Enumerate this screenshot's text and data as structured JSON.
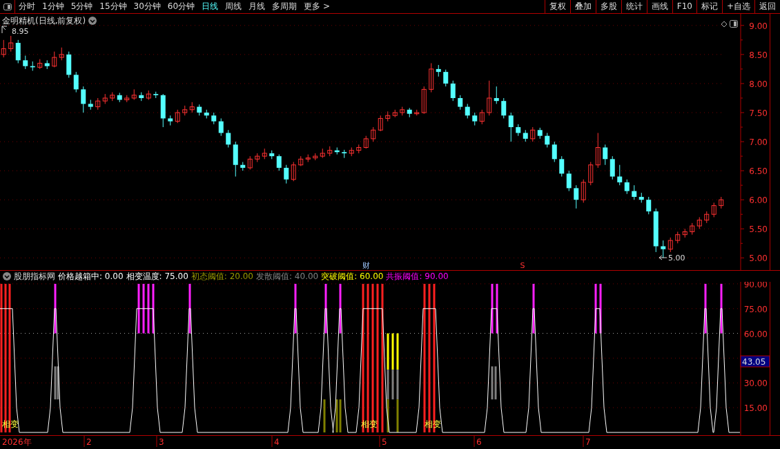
{
  "toolbar": {
    "periods": [
      {
        "label": "分时",
        "selected": false
      },
      {
        "label": "1分钟",
        "selected": false
      },
      {
        "label": "5分钟",
        "selected": false
      },
      {
        "label": "15分钟",
        "selected": false
      },
      {
        "label": "30分钟",
        "selected": false
      },
      {
        "label": "60分钟",
        "selected": false
      },
      {
        "label": "日线",
        "selected": true
      },
      {
        "label": "周线",
        "selected": false
      },
      {
        "label": "月线",
        "selected": false
      },
      {
        "label": "多周期",
        "selected": false
      },
      {
        "label": "更多 >",
        "selected": false
      }
    ],
    "actions": [
      "复权",
      "叠加",
      "多股",
      "统计",
      "画线",
      "F10",
      "标记",
      "+自选",
      "返回"
    ]
  },
  "main_chart": {
    "title": "金明精机(日线,前复权)",
    "high_label": "8.95",
    "low_label": "5.00",
    "chart_data": {
      "type": "candlestick",
      "ylim": [
        4.79,
        9.2
      ],
      "grid": true,
      "yticks": [
        {
          "value": 9,
          "label": "9.00"
        },
        {
          "value": 8.5,
          "label": "8.50"
        },
        {
          "value": 8,
          "label": "8.00"
        },
        {
          "value": 7.5,
          "label": "7.50"
        },
        {
          "value": 7,
          "label": "7.00"
        },
        {
          "value": 6.5,
          "label": "6.50"
        },
        {
          "value": 6,
          "label": "6.00"
        },
        {
          "value": 5.5,
          "label": "5.50"
        },
        {
          "value": 5,
          "label": "5.00"
        }
      ],
      "ohlc": [
        [
          8.5,
          8.75,
          8.45,
          8.6
        ],
        [
          8.6,
          8.82,
          8.55,
          8.7
        ],
        [
          8.7,
          8.75,
          8.35,
          8.4
        ],
        [
          8.4,
          8.48,
          8.25,
          8.3
        ],
        [
          8.3,
          8.38,
          8.22,
          8.28
        ],
        [
          8.28,
          8.42,
          8.25,
          8.35
        ],
        [
          8.35,
          8.4,
          8.25,
          8.3
        ],
        [
          8.3,
          8.55,
          8.28,
          8.45
        ],
        [
          8.45,
          8.62,
          8.4,
          8.5
        ],
        [
          8.5,
          8.55,
          8.1,
          8.15
        ],
        [
          8.15,
          8.2,
          7.85,
          7.9
        ],
        [
          7.9,
          7.95,
          7.5,
          7.65
        ],
        [
          7.65,
          7.72,
          7.55,
          7.6
        ],
        [
          7.6,
          7.75,
          7.55,
          7.7
        ],
        [
          7.7,
          7.82,
          7.65,
          7.75
        ],
        [
          7.75,
          7.85,
          7.7,
          7.8
        ],
        [
          7.8,
          7.84,
          7.68,
          7.72
        ],
        [
          7.72,
          7.8,
          7.68,
          7.75
        ],
        [
          7.75,
          7.9,
          7.72,
          7.8
        ],
        [
          7.8,
          7.85,
          7.7,
          7.75
        ],
        [
          7.75,
          7.88,
          7.72,
          7.82
        ],
        [
          7.82,
          7.86,
          7.75,
          7.8
        ],
        [
          7.8,
          7.82,
          7.25,
          7.4
        ],
        [
          7.4,
          7.45,
          7.28,
          7.35
        ],
        [
          7.35,
          7.55,
          7.32,
          7.5
        ],
        [
          7.5,
          7.62,
          7.45,
          7.55
        ],
        [
          7.55,
          7.68,
          7.5,
          7.6
        ],
        [
          7.6,
          7.64,
          7.45,
          7.5
        ],
        [
          7.5,
          7.55,
          7.4,
          7.45
        ],
        [
          7.45,
          7.5,
          7.3,
          7.35
        ],
        [
          7.35,
          7.4,
          7.1,
          7.15
        ],
        [
          7.15,
          7.2,
          6.9,
          6.95
        ],
        [
          6.95,
          7.0,
          6.4,
          6.6
        ],
        [
          6.6,
          6.65,
          6.5,
          6.55
        ],
        [
          6.55,
          6.75,
          6.52,
          6.7
        ],
        [
          6.7,
          6.8,
          6.65,
          6.75
        ],
        [
          6.75,
          6.88,
          6.7,
          6.8
        ],
        [
          6.8,
          6.85,
          6.7,
          6.75
        ],
        [
          6.75,
          6.78,
          6.5,
          6.55
        ],
        [
          6.55,
          6.6,
          6.28,
          6.35
        ],
        [
          6.35,
          6.65,
          6.32,
          6.6
        ],
        [
          6.6,
          6.75,
          6.58,
          6.7
        ],
        [
          6.7,
          6.78,
          6.65,
          6.72
        ],
        [
          6.72,
          6.8,
          6.68,
          6.75
        ],
        [
          6.75,
          6.88,
          6.72,
          6.8
        ],
        [
          6.8,
          6.92,
          6.75,
          6.85
        ],
        [
          6.85,
          6.9,
          6.78,
          6.82
        ],
        [
          6.82,
          6.86,
          6.72,
          6.8
        ],
        [
          6.8,
          6.9,
          6.75,
          6.85
        ],
        [
          6.85,
          6.95,
          6.8,
          6.9
        ],
        [
          6.9,
          7.1,
          6.88,
          7.05
        ],
        [
          7.05,
          7.25,
          7.0,
          7.2
        ],
        [
          7.2,
          7.45,
          7.18,
          7.4
        ],
        [
          7.4,
          7.52,
          7.35,
          7.45
        ],
        [
          7.45,
          7.55,
          7.42,
          7.5
        ],
        [
          7.5,
          7.6,
          7.45,
          7.55
        ],
        [
          7.55,
          7.58,
          7.42,
          7.48
        ],
        [
          7.48,
          7.55,
          7.45,
          7.5
        ],
        [
          7.5,
          7.95,
          7.48,
          7.9
        ],
        [
          7.9,
          8.35,
          7.85,
          8.25
        ],
        [
          8.25,
          8.32,
          8.12,
          8.2
        ],
        [
          8.2,
          8.24,
          7.95,
          8.0
        ],
        [
          8.0,
          8.05,
          7.7,
          7.75
        ],
        [
          7.75,
          7.8,
          7.55,
          7.6
        ],
        [
          7.6,
          7.65,
          7.4,
          7.45
        ],
        [
          7.45,
          7.5,
          7.28,
          7.35
        ],
        [
          7.35,
          7.55,
          7.3,
          7.5
        ],
        [
          7.5,
          8.05,
          7.45,
          7.75
        ],
        [
          7.75,
          7.95,
          7.65,
          7.7
        ],
        [
          7.7,
          7.75,
          7.4,
          7.45
        ],
        [
          7.45,
          7.5,
          7.0,
          7.25
        ],
        [
          7.25,
          7.3,
          7.1,
          7.15
        ],
        [
          7.15,
          7.2,
          7.0,
          7.05
        ],
        [
          7.05,
          7.25,
          7.0,
          7.2
        ],
        [
          7.2,
          7.24,
          7.05,
          7.1
        ],
        [
          7.1,
          7.15,
          6.9,
          6.95
        ],
        [
          6.95,
          7.0,
          6.65,
          6.7
        ],
        [
          6.7,
          6.75,
          6.4,
          6.45
        ],
        [
          6.45,
          6.5,
          6.15,
          6.2
        ],
        [
          6.2,
          6.25,
          5.85,
          6.0
        ],
        [
          6.0,
          6.35,
          5.95,
          6.3
        ],
        [
          6.3,
          6.65,
          6.25,
          6.6
        ],
        [
          6.6,
          7.15,
          6.55,
          6.9
        ],
        [
          6.9,
          6.95,
          6.6,
          6.7
        ],
        [
          6.7,
          6.75,
          6.35,
          6.4
        ],
        [
          6.4,
          6.6,
          6.25,
          6.3
        ],
        [
          6.3,
          6.35,
          6.1,
          6.15
        ],
        [
          6.15,
          6.25,
          6.0,
          6.05
        ],
        [
          6.05,
          6.12,
          5.95,
          6.0
        ],
        [
          6.0,
          6.05,
          5.75,
          5.8
        ],
        [
          5.8,
          5.85,
          5.1,
          5.2
        ],
        [
          5.2,
          5.3,
          5.0,
          5.15
        ],
        [
          5.15,
          5.35,
          5.1,
          5.3
        ],
        [
          5.3,
          5.45,
          5.25,
          5.4
        ],
        [
          5.4,
          5.5,
          5.35,
          5.45
        ],
        [
          5.45,
          5.6,
          5.4,
          5.55
        ],
        [
          5.55,
          5.7,
          5.5,
          5.65
        ],
        [
          5.65,
          5.8,
          5.6,
          5.75
        ],
        [
          5.75,
          5.95,
          5.7,
          5.9
        ],
        [
          5.9,
          6.05,
          5.85,
          6.0
        ]
      ]
    },
    "markers": [
      {
        "text": "财",
        "kind": "finance"
      },
      {
        "text": "S",
        "kind": "signal"
      }
    ]
  },
  "indicator": {
    "name": "股朋指标网",
    "readouts": [
      {
        "label": "价格越箱中:",
        "value": "0.00",
        "color": "#ffffff"
      },
      {
        "label": "相变温度:",
        "value": "75.00",
        "color": "#ffffff"
      },
      {
        "label": "初态阈值:",
        "value": "20.00",
        "color": "#999900"
      },
      {
        "label": "发散阈值:",
        "value": "40.00",
        "color": "#808080"
      },
      {
        "label": "突破阈值:",
        "value": "60.00",
        "color": "#ffff00"
      },
      {
        "label": "共振阈值:",
        "value": "90.00",
        "color": "#ff00ff"
      }
    ],
    "axis": [
      "90.00",
      "75.00",
      "60.00",
      "30.00",
      "15.00"
    ],
    "current_value": "43.05",
    "phase_labels": [
      "相变",
      "相变",
      "相变"
    ]
  },
  "time_axis": [
    "2026年",
    "2",
    "3",
    "4",
    "5",
    "6",
    "7"
  ]
}
